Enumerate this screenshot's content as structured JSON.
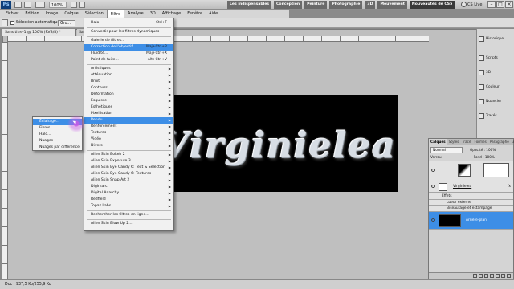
{
  "app": {
    "logo": "Ps",
    "zoom": "100%"
  },
  "workspaces": [
    "Les indispensables",
    "Conception",
    "Peinture",
    "Photographie",
    "3D",
    "Mouvement",
    "Nouveautés de CS5"
  ],
  "cs_live": "CS Live",
  "window_buttons": [
    "–",
    "□",
    "×"
  ],
  "menubar": [
    "Fichier",
    "Edition",
    "Image",
    "Calque",
    "Sélection",
    "Filtre",
    "Analyse",
    "3D",
    "Affichage",
    "Fenêtre",
    "Aide"
  ],
  "options": {
    "auto_select": "Sélection automatique :",
    "group": "Gro..."
  },
  "document": {
    "tab": "Sans titre-1 @ 100% (RVB/8) *",
    "tab2": "Sans",
    "canvas_text": "Virginielea"
  },
  "status": "Doc : 937,5 Ko/255,9 Ko",
  "colors": {
    "highlight": "#3d8ee6",
    "panel": "#d4d4d4",
    "canvas": "#000000"
  },
  "filter_menu": {
    "items": [
      {
        "label": "Halo",
        "shortcut": "Ctrl+F"
      },
      {
        "label": "Convertir pour les filtres dynamiques"
      },
      {
        "label": "Galerie de filtres..."
      },
      {
        "label": "Correction de l'objectif...",
        "shortcut": "Maj+Ctrl+R",
        "highlight": true
      },
      {
        "label": "Fluidité...",
        "shortcut": "Maj+Ctrl+X"
      },
      {
        "label": "Point de fuite...",
        "shortcut": "Alt+Ctrl+V"
      },
      {
        "label": "Artistiques",
        "sub": true
      },
      {
        "label": "Atténuation",
        "sub": true
      },
      {
        "label": "Bruit",
        "sub": true
      },
      {
        "label": "Contours",
        "sub": true
      },
      {
        "label": "Déformation",
        "sub": true
      },
      {
        "label": "Esquisse",
        "sub": true
      },
      {
        "label": "Esthétiques",
        "sub": true
      },
      {
        "label": "Pixellisation",
        "sub": true
      },
      {
        "label": "Rendu",
        "sub": true,
        "highlight": true
      },
      {
        "label": "Renforcement",
        "sub": true
      },
      {
        "label": "Textures",
        "sub": true
      },
      {
        "label": "Vidéo",
        "sub": true
      },
      {
        "label": "Divers",
        "sub": true
      },
      {
        "label": "Alien Skin Bokeh 2",
        "sub": true
      },
      {
        "label": "Alien Skin Exposure 3",
        "sub": true
      },
      {
        "label": "Alien Skin Eye Candy 6: Text & Selection",
        "sub": true
      },
      {
        "label": "Alien Skin Eye Candy 6: Textures",
        "sub": true
      },
      {
        "label": "Alien Skin Snap Art 2",
        "sub": true
      },
      {
        "label": "Digimarc",
        "sub": true
      },
      {
        "label": "Digital Anarchy",
        "sub": true
      },
      {
        "label": "Redfield",
        "sub": true
      },
      {
        "label": "Topaz Labs",
        "sub": true
      },
      {
        "label": "Rechercher les filtres en ligne..."
      },
      {
        "label": "Alien Skin Blow Up 2..."
      }
    ]
  },
  "render_submenu": [
    "Éclairage...",
    "Fibres...",
    "Halo...",
    "Nuages",
    "Nuages par différence"
  ],
  "dock": [
    "Historique",
    "Scripts",
    "3D",
    "Couleur",
    "Nuancier",
    "Tracés"
  ],
  "layers_panel": {
    "tabs": [
      "Calques",
      "Styles",
      "Tracé",
      "Formes",
      "Paragraphe",
      "3D",
      "Couches"
    ],
    "blend_mode": "Normal",
    "opacity_label": "Opacité : 100%",
    "fill_label": "Fond : 100%",
    "lock_label": "Verrou :",
    "layers": [
      {
        "name": "",
        "type": "mask"
      },
      {
        "name": "Virginielea",
        "type": "text",
        "fx": "fx"
      },
      {
        "name": "Effets",
        "type": "effect"
      },
      {
        "name": "Lueur externe",
        "type": "effect-item"
      },
      {
        "name": "Biseautage et estampage",
        "type": "effect-item"
      },
      {
        "name": "Arrière-plan",
        "type": "background",
        "selected": true
      }
    ]
  }
}
